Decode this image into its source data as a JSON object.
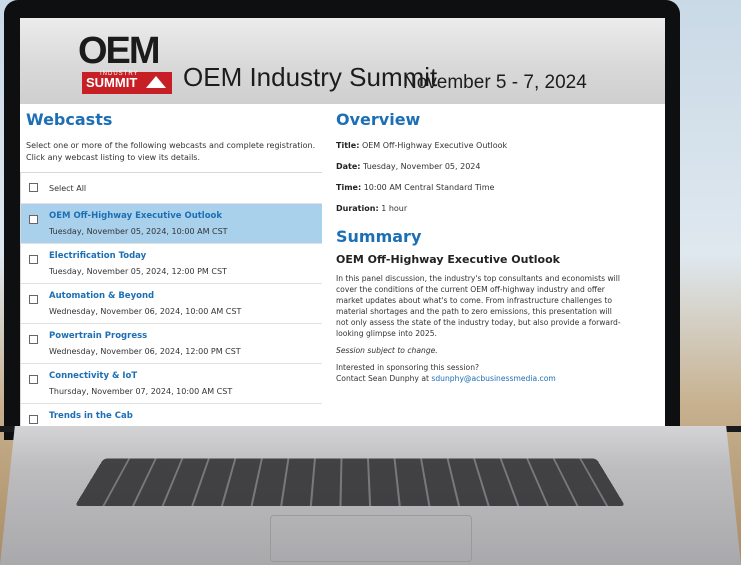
{
  "banner": {
    "logo_top": "OEM",
    "logo_industry": "INDUSTRY",
    "logo_summit": "SUMMIT",
    "title": "OEM Industry Summit",
    "dates": "November 5 - 7, 2024"
  },
  "webcasts": {
    "heading": "Webcasts",
    "intro_line1": "Select one or more of the following webcasts and complete registration.",
    "intro_line2": "Click any webcast listing to view its details.",
    "select_all": "Select All",
    "items": [
      {
        "title": "OEM Off-Highway Executive Outlook",
        "date": "Tuesday, November 05, 2024, 10:00 AM CST"
      },
      {
        "title": "Electrification Today",
        "date": "Tuesday, November 05, 2024, 12:00 PM CST"
      },
      {
        "title": "Automation & Beyond",
        "date": "Wednesday, November 06, 2024, 10:00 AM CST"
      },
      {
        "title": "Powertrain Progress",
        "date": "Wednesday, November 06, 2024, 12:00 PM CST"
      },
      {
        "title": "Connectivity & IoT",
        "date": "Thursday, November 07, 2024, 10:00 AM CST"
      },
      {
        "title": "Trends in the Cab",
        "date": ""
      }
    ]
  },
  "overview": {
    "heading": "Overview",
    "title_label": "Title:",
    "title_value": "OEM Off-Highway Executive Outlook",
    "date_label": "Date:",
    "date_value": "Tuesday, November 05, 2024",
    "time_label": "Time:",
    "time_value": "10:00 AM Central Standard Time",
    "duration_label": "Duration:",
    "duration_value": "1 hour"
  },
  "summary": {
    "heading": "Summary",
    "session_title": "OEM Off-Highway Executive Outlook",
    "body_lines": [
      "In this panel discussion, the industry's top consultants and economists will",
      "cover the conditions of the current OEM off-highway industry and offer",
      "market updates about what's to come. From infrastructure challenges to",
      "material shortages and the path to zero emissions, this presentation will",
      "not only assess the state of the industry today, but also provide a forward-",
      "looking glimpse into 2025."
    ],
    "note": "Session subject to change.",
    "sponsor_line1": "Interested in sponsoring this session?",
    "sponsor_line2_prefix": "Contact Sean Dunphy at",
    "sponsor_email": "sdunphy@acbusinessmedia.com"
  }
}
